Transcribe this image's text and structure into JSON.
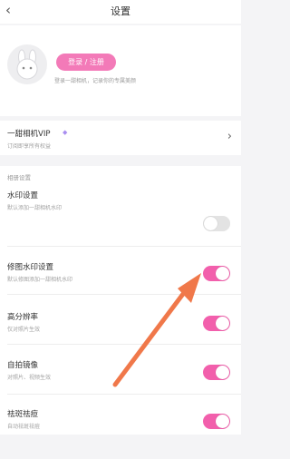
{
  "header": {
    "title": "设置",
    "back_icon": "chevron-left-icon"
  },
  "profile": {
    "login_label": "登录 / 注册",
    "subtitle": "登录一甜相机，记录你的专属美颜"
  },
  "vip": {
    "title": "一甜相机VIP",
    "subtitle": "订阅即享所有权益",
    "diamond_icon": "diamond-icon",
    "chevron_icon": "chevron-right-icon"
  },
  "camera_settings": {
    "section_label": "相册设置",
    "rows": [
      {
        "title": "水印设置",
        "subtitle": "默认添加一甜相机水印",
        "enabled": false
      },
      {
        "title": "修图水印设置",
        "subtitle": "默认修图添加一甜相机水印",
        "enabled": true
      },
      {
        "title": "高分辨率",
        "subtitle": "仅对照片生效",
        "enabled": true
      },
      {
        "title": "自拍镜像",
        "subtitle": "对照片、视频生效",
        "enabled": true
      },
      {
        "title": "祛斑祛痘",
        "subtitle": "自动祛斑祛痘",
        "enabled": true
      }
    ]
  },
  "colors": {
    "accent": "#f25fac",
    "login_button": "#f37ab8",
    "arrow": "#f0784a"
  }
}
